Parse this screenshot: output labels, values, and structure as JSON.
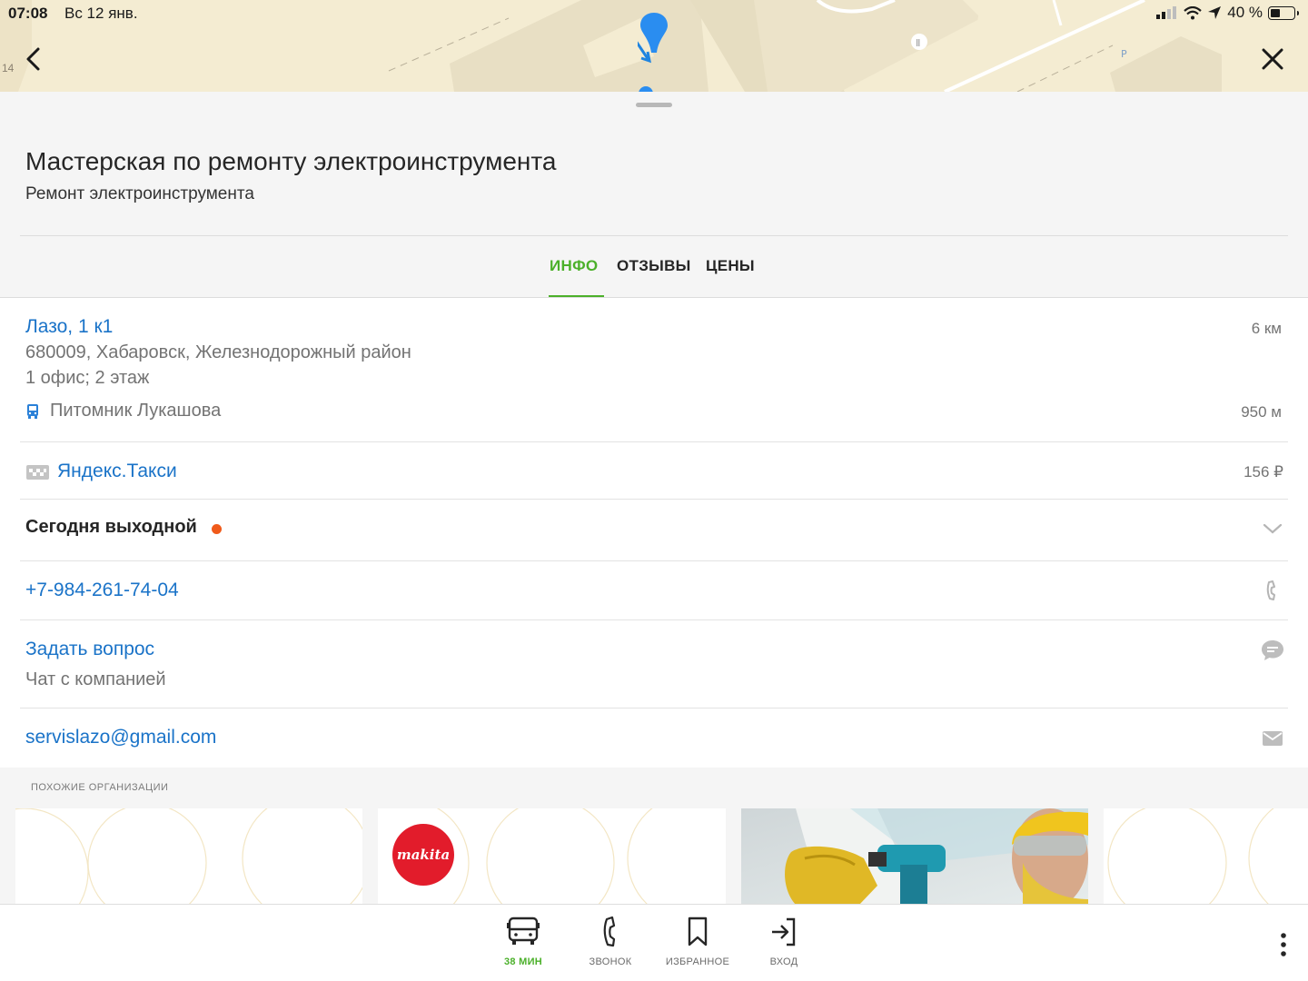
{
  "status_bar": {
    "time": "07:08",
    "date": "Вс 12 янв.",
    "battery": "40 %",
    "battery_level": 0.4
  },
  "map": {
    "label_house": "14",
    "label_parking": "P"
  },
  "place": {
    "title": "Мастерская по ремонту электроинструмента",
    "category": "Ремонт электроинструмента"
  },
  "tabs": [
    {
      "label": "ИНФО",
      "active": true
    },
    {
      "label": "ОТЗЫВЫ",
      "active": false
    },
    {
      "label": "ЦЕНЫ",
      "active": false
    }
  ],
  "info": {
    "address": "Лазо, 1 к1",
    "address_distance": "6 км",
    "address_line2": "680009, Хабаровск, Железнодорожный район",
    "address_line3": "1 офис; 2 этаж",
    "stop_name": "Питомник Лукашова",
    "stop_distance": "950 м",
    "taxi_label": "Яндекс.Такси",
    "taxi_price": "156 ₽",
    "hours": "Сегодня выходной",
    "hours_status_color": "#f05a1a",
    "phone": "+7-984-261-74-04",
    "ask_label": "Задать вопрос",
    "ask_sub": "Чат с компанией",
    "email": "servislazo@gmail.com"
  },
  "similar": {
    "title": "ПОХОЖИЕ ОРГАНИЗАЦИИ",
    "makita_logo": "makita"
  },
  "bottom_nav": {
    "route": "38 МИН",
    "call": "ЗВОНОК",
    "favorites": "ИЗБРАННОЕ",
    "login": "ВХОД"
  },
  "colors": {
    "accent_green": "#4bb02a",
    "link_blue": "#1a73c8",
    "makita_red": "#e21c2b"
  }
}
